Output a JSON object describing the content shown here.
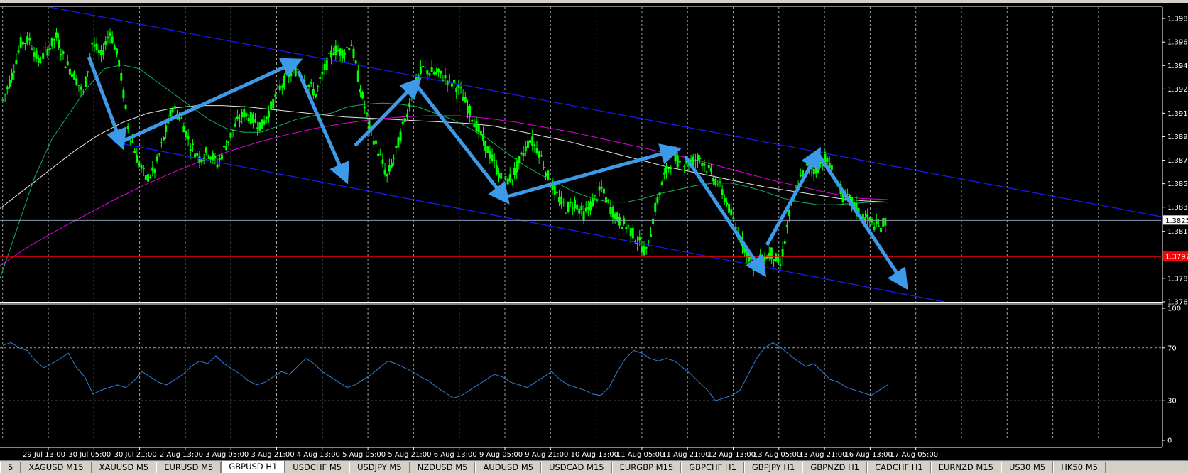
{
  "chart_data": [
    {
      "type": "line",
      "symbol_tab": "GBPUSD H1",
      "y_ticks": [
        "1.39845",
        "1.39660",
        "1.39475",
        "1.39290",
        "1.39100",
        "1.38915",
        "1.38730",
        "1.38545",
        "1.38360",
        "1.38170",
        "1.37800",
        "1.37615"
      ],
      "y_tick_values": [
        1.39845,
        1.3966,
        1.39475,
        1.3929,
        1.391,
        1.38915,
        1.3873,
        1.38545,
        1.3836,
        1.3817,
        1.378,
        1.37615
      ],
      "ylim": [
        1.37615,
        1.39935
      ],
      "current_price_label": "1.38256",
      "current_price": 1.38256,
      "red_level_label": "1.37972",
      "red_level": 1.37972,
      "x_labels": [
        "29 Jul 13:00",
        "30 Jul 05:00",
        "30 Jul 21:00",
        "2 Aug 13:00",
        "3 Aug 05:00",
        "3 Aug 21:00",
        "4 Aug 13:00",
        "5 Aug 05:00",
        "5 Aug 21:00",
        "6 Aug 13:00",
        "9 Aug 05:00",
        "9 Aug 21:00",
        "10 Aug 13:00",
        "11 Aug 05:00",
        "11 Aug 21:00",
        "12 Aug 13:00",
        "13 Aug 05:00",
        "13 Aug 21:00",
        "16 Aug 13:00",
        "17 Aug 05:00"
      ],
      "price_close": [
        1.392,
        1.394,
        1.3965,
        1.3968,
        1.395,
        1.396,
        1.397,
        1.395,
        1.394,
        1.3925,
        1.3965,
        1.3955,
        1.3975,
        1.395,
        1.39,
        1.3875,
        1.3858,
        1.3865,
        1.389,
        1.3915,
        1.3905,
        1.3885,
        1.3875,
        1.388,
        1.387,
        1.3885,
        1.39,
        1.391,
        1.3905,
        1.39,
        1.3915,
        1.393,
        1.394,
        1.3945,
        1.3935,
        1.3925,
        1.3945,
        1.396,
        1.3958,
        1.3965,
        1.393,
        1.39,
        1.388,
        1.386,
        1.388,
        1.3905,
        1.393,
        1.3945,
        1.3942,
        1.394,
        1.3935,
        1.393,
        1.3915,
        1.39,
        1.3885,
        1.387,
        1.3855,
        1.386,
        1.3875,
        1.389,
        1.388,
        1.386,
        1.3845,
        1.3835,
        1.384,
        1.383,
        1.384,
        1.385,
        1.3835,
        1.3825,
        1.382,
        1.381,
        1.38,
        1.3835,
        1.386,
        1.3875,
        1.387,
        1.3872,
        1.3875,
        1.3865,
        1.3855,
        1.384,
        1.382,
        1.3805,
        1.379,
        1.3795,
        1.38,
        1.379,
        1.383,
        1.3855,
        1.387,
        1.3865,
        1.3875,
        1.3862,
        1.3845,
        1.384,
        1.383,
        1.3825,
        1.382,
        1.3826
      ],
      "ma_green": [
        1.378,
        1.382,
        1.386,
        1.389,
        1.391,
        1.393,
        1.3945,
        1.3948,
        1.3945,
        1.3935,
        1.3925,
        1.3915,
        1.3905,
        1.3898,
        1.3895,
        1.3895,
        1.39,
        1.3905,
        1.3908,
        1.391,
        1.3915,
        1.3917,
        1.3918,
        1.3917,
        1.3915,
        1.391,
        1.3905,
        1.3898,
        1.389,
        1.388,
        1.387,
        1.3862,
        1.3855,
        1.3848,
        1.3843,
        1.384,
        1.384,
        1.3843,
        1.3847,
        1.385,
        1.3853,
        1.3855,
        1.3855,
        1.3852,
        1.3848,
        1.3843,
        1.384,
        1.3838,
        1.3838,
        1.3839,
        1.384,
        1.384
      ],
      "ma_white": [
        1.3835,
        1.385,
        1.3865,
        1.388,
        1.3893,
        1.3903,
        1.391,
        1.3914,
        1.3916,
        1.3916,
        1.3915,
        1.3913,
        1.3911,
        1.3909,
        1.3907,
        1.3906,
        1.3905,
        1.3904,
        1.3903,
        1.3902,
        1.39,
        1.3896,
        1.3892,
        1.3888,
        1.3883,
        1.3878,
        1.3873,
        1.3868,
        1.3864,
        1.386,
        1.3856,
        1.3852,
        1.3849,
        1.3846,
        1.3843,
        1.3841,
        1.384
      ],
      "ma_magenta": [
        1.379,
        1.3805,
        1.3818,
        1.383,
        1.3842,
        1.3853,
        1.3863,
        1.3872,
        1.388,
        1.3887,
        1.3893,
        1.3898,
        1.3902,
        1.3905,
        1.3907,
        1.3908,
        1.3908,
        1.3906,
        1.3903,
        1.3899,
        1.3895,
        1.389,
        1.3885,
        1.388,
        1.3875,
        1.3869,
        1.3863,
        1.3857,
        1.3852,
        1.3847,
        1.3843,
        1.3842
      ],
      "rsi": {
        "ticks": [
          "100",
          "70",
          "30",
          "0"
        ],
        "tick_values": [
          100,
          70,
          30,
          0
        ],
        "ylim": [
          0,
          100
        ],
        "values": [
          72,
          74,
          70,
          68,
          60,
          55,
          58,
          62,
          66,
          55,
          48,
          35,
          38,
          40,
          42,
          40,
          45,
          52,
          48,
          44,
          42,
          46,
          50,
          56,
          60,
          58,
          64,
          58,
          54,
          50,
          45,
          42,
          44,
          48,
          52,
          50,
          56,
          62,
          58,
          52,
          48,
          44,
          40,
          42,
          46,
          50,
          55,
          60,
          58,
          55,
          52,
          48,
          45,
          40,
          36,
          32,
          34,
          38,
          42,
          46,
          50,
          48,
          44,
          42,
          40,
          44,
          48,
          52,
          46,
          42,
          40,
          38,
          35,
          34,
          40,
          52,
          62,
          68,
          66,
          62,
          60,
          62,
          60,
          55,
          50,
          44,
          38,
          30,
          32,
          34,
          38,
          50,
          62,
          70,
          74,
          70,
          65,
          60,
          56,
          58,
          52,
          46,
          44,
          40,
          38,
          36,
          34,
          38,
          42
        ]
      }
    }
  ],
  "tabs": [
    "5",
    "XAGUSD M15",
    "XAUUSD M5",
    "EURUSD M5",
    "GBPUSD H1",
    "USDCHF M5",
    "USDJPY M5",
    "NZDUSD M5",
    "AUDUSD M5",
    "USDCAD M15",
    "EURGBP M15",
    "GBPCHF H1",
    "GBPJPY H1",
    "GBPNZD H1",
    "CADCHF H1",
    "EURNZD M15",
    "US30 M5",
    "HK50 M5"
  ],
  "colors": {
    "background": "#000000",
    "candle": "#00ff00",
    "channel": "#1a1aff",
    "arrow": "#3d9ae8",
    "ma_green": "#10b060",
    "ma_white": "#e8e8e8",
    "ma_magenta": "#e000e0",
    "price_line": "#8899aa",
    "red_level": "#ff0000",
    "rsi": "#2e7fd9",
    "grid": "#c8c8c8"
  }
}
